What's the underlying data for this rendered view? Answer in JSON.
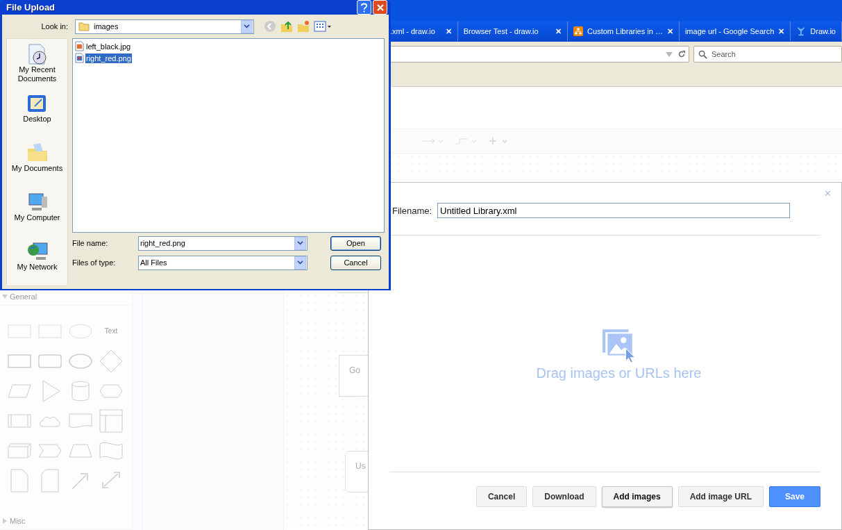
{
  "browser": {
    "tabs": [
      {
        "title": ".xml - draw.io",
        "kind": "page",
        "close": "✕"
      },
      {
        "title": "Browser Test - draw.io",
        "kind": "page",
        "close": "✕"
      },
      {
        "title": "Custom Libraries in …",
        "kind": "drawio",
        "close": "✕"
      },
      {
        "title": "image url - Google Search",
        "kind": "page",
        "close": "✕"
      },
      {
        "title": "Draw.io",
        "kind": "jira"
      }
    ],
    "search": {
      "placeholder": "Search"
    }
  },
  "editor": {
    "sidebar": {
      "sections": [
        {
          "title": "General",
          "expanded": true
        },
        {
          "title": "Misc",
          "expanded": false
        }
      ],
      "shape_text": "Text"
    },
    "diagram_labels": [
      "Go",
      "Us"
    ]
  },
  "library_dialog": {
    "close": "✕",
    "filename_label": "Filename:",
    "filename": "Untitled Library.xml",
    "drop_hint": "Drag images or URLs here",
    "buttons": [
      {
        "label": "Cancel",
        "kind": "plain",
        "focused": false
      },
      {
        "label": "Download",
        "kind": "plain",
        "focused": false
      },
      {
        "label": "Add images",
        "kind": "plain",
        "focused": true
      },
      {
        "label": "Add image URL",
        "kind": "plain",
        "focused": false
      },
      {
        "label": "Save",
        "kind": "primary",
        "focused": false
      }
    ]
  },
  "file_dialog": {
    "title": "File Upload",
    "look_in_label": "Look in:",
    "look_in": "images",
    "places": [
      {
        "label": "My Recent Documents",
        "kind": "recent"
      },
      {
        "label": "Desktop",
        "kind": "desktop"
      },
      {
        "label": "My Documents",
        "kind": "documents"
      },
      {
        "label": "My Computer",
        "kind": "computer"
      },
      {
        "label": "My Network",
        "kind": "network"
      }
    ],
    "files": [
      {
        "name": "left_black.jpg",
        "kind": "jpg",
        "selected": false
      },
      {
        "name": "right_red.png",
        "kind": "png",
        "selected": true
      }
    ],
    "file_name_label": "File name:",
    "file_name": "right_red.png",
    "file_type_label": "Files of type:",
    "file_type": "All Files",
    "buttons": [
      "Open",
      "Cancel"
    ]
  }
}
